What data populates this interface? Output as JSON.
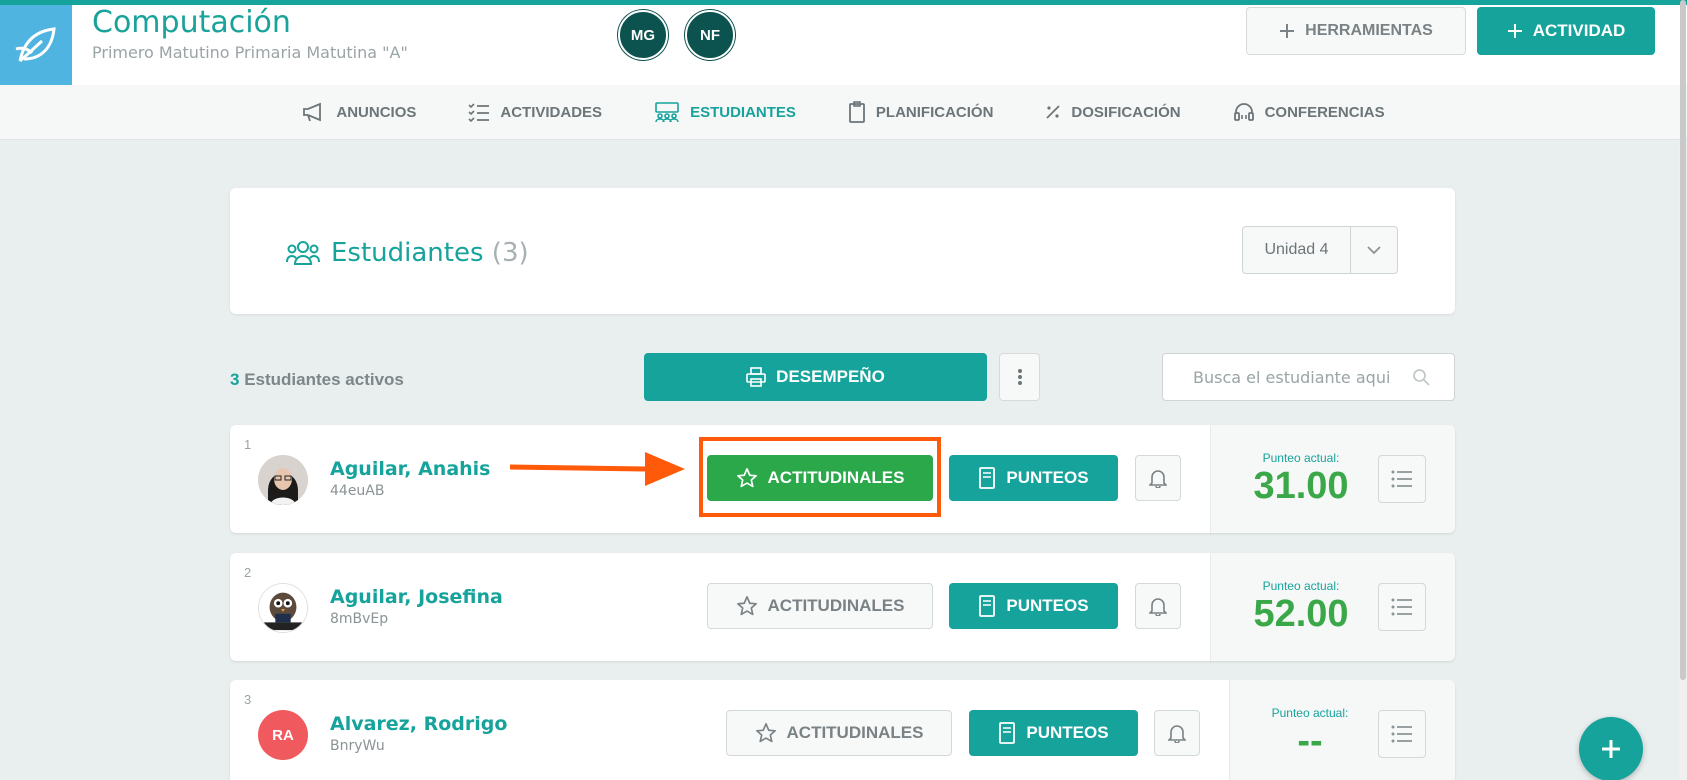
{
  "header": {
    "course_title": "Computación",
    "course_subtitle": "Primero Matutino Primaria Matutina \"A\"",
    "teachers": [
      "MG",
      "NF"
    ],
    "tools_label": "HERRAMIENTAS",
    "activity_label": "ACTIVIDAD"
  },
  "nav": {
    "items": [
      {
        "label": "ANUNCIOS",
        "icon": "megaphone-icon"
      },
      {
        "label": "ACTIVIDADES",
        "icon": "checklist-icon"
      },
      {
        "label": "ESTUDIANTES",
        "icon": "students-icon",
        "active": true
      },
      {
        "label": "PLANIFICACIÓN",
        "icon": "clipboard-icon"
      },
      {
        "label": "DOSIFICACIÓN",
        "icon": "percent-icon"
      },
      {
        "label": "CONFERENCIAS",
        "icon": "headset-icon"
      }
    ]
  },
  "students_card": {
    "title": "Estudiantes",
    "count": "(3)",
    "unit_selected": "Unidad 4"
  },
  "toolbar": {
    "active_count": "3",
    "active_label": "Estudiantes activos",
    "performance_label": "DESEMPEÑO",
    "search_placeholder": "Busca el estudiante aqui"
  },
  "students": [
    {
      "num": "1",
      "name": "Aguilar, Anahis",
      "code": "44euAB",
      "attitudinal_label": "ACTITUDINALES",
      "scores_label": "PUNTEOS",
      "score_label": "Punteo actual:",
      "score": "31.00"
    },
    {
      "num": "2",
      "name": "Aguilar, Josefina",
      "code": "8mBvEp",
      "attitudinal_label": "ACTITUDINALES",
      "scores_label": "PUNTEOS",
      "score_label": "Punteo actual:",
      "score": "52.00"
    },
    {
      "num": "3",
      "name": "Alvarez, Rodrigo",
      "code": "BnryWu",
      "initials": "RA",
      "attitudinal_label": "ACTITUDINALES",
      "scores_label": "PUNTEOS",
      "score_label": "Punteo actual:",
      "score": "--"
    }
  ],
  "colors": {
    "accent": "#16a39c",
    "green": "#2aa84a",
    "highlight": "#ff5a09",
    "logo_bg": "#4fb4e0"
  }
}
